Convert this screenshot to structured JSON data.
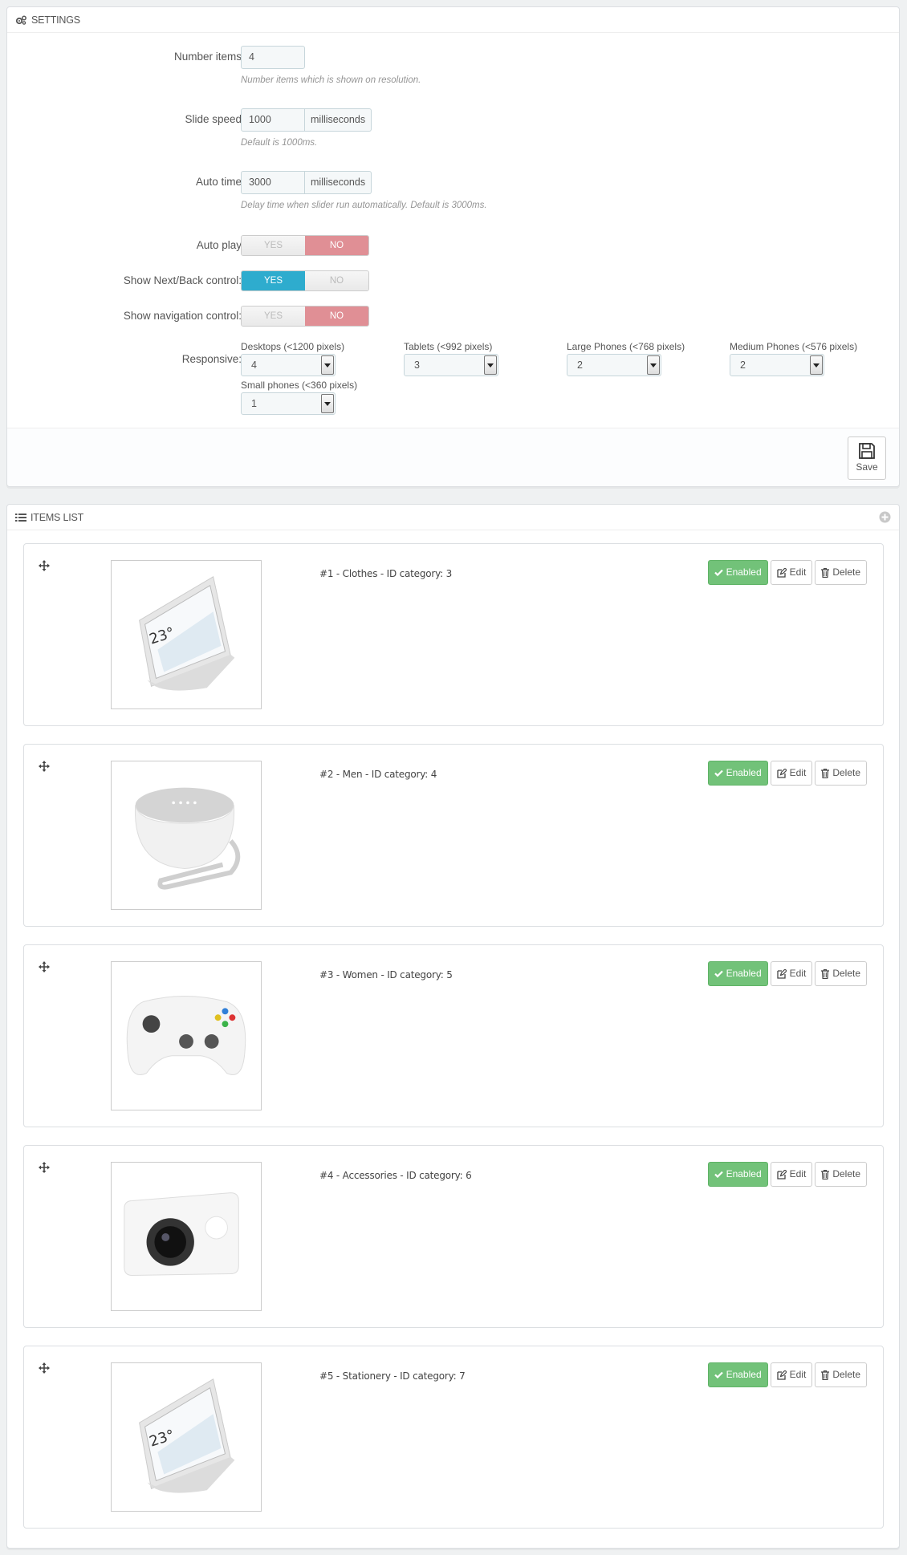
{
  "settings": {
    "heading": "Settings",
    "number_items": {
      "label": "Number items",
      "value": "4",
      "help": "Number items which is shown on resolution."
    },
    "slide_speed": {
      "label": "Slide speed",
      "value": "1000",
      "unit": "milliseconds",
      "help": "Default is 1000ms."
    },
    "auto_time": {
      "label": "Auto time",
      "value": "3000",
      "unit": "milliseconds",
      "help": "Delay time when slider run automatically. Default is 3000ms."
    },
    "auto_play": {
      "label": "Auto play",
      "yes": "YES",
      "no": "NO",
      "selected": "NO"
    },
    "show_next_back": {
      "label": "Show Next/Back control:",
      "yes": "YES",
      "no": "NO",
      "selected": "YES"
    },
    "show_navigation": {
      "label": "Show navigation control:",
      "yes": "YES",
      "no": "NO",
      "selected": "NO"
    },
    "responsive": {
      "label": "Responsive:",
      "desktops": {
        "label": "Desktops (<1200 pixels)",
        "value": "4"
      },
      "tablets": {
        "label": "Tablets (<992 pixels)",
        "value": "3"
      },
      "large_phones": {
        "label": "Large Phones (<768 pixels)",
        "value": "2"
      },
      "medium_phones": {
        "label": "Medium Phones (<576 pixels)",
        "value": "2"
      },
      "small_phones": {
        "label": "Small phones (<360 pixels)",
        "value": "1"
      }
    },
    "save_label": "Save"
  },
  "items_list": {
    "heading": "Items list",
    "enabled_label": "Enabled",
    "edit_label": "Edit",
    "delete_label": "Delete",
    "items": [
      {
        "title": "#1 - Clothes - ID category: 3",
        "image": "smart-display"
      },
      {
        "title": "#2 - Men - ID category: 4",
        "image": "smart-speaker"
      },
      {
        "title": "#3 - Women - ID category: 5",
        "image": "game-controller"
      },
      {
        "title": "#4 - Accessories - ID category: 6",
        "image": "action-camera"
      },
      {
        "title": "#5 - Stationery - ID category: 7",
        "image": "smart-display"
      }
    ]
  },
  "colors": {
    "enabled": "#72c279",
    "switch_yes": "#2eacce",
    "switch_no": "#e08f95"
  }
}
